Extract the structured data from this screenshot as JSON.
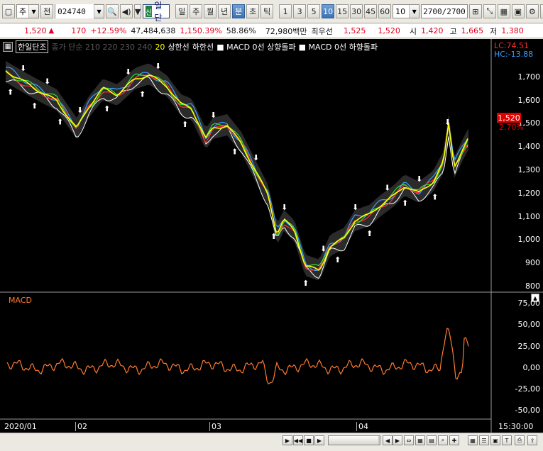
{
  "toolbar": {
    "type_label": "주",
    "prev_label": "전",
    "code": "024740",
    "badge": "신",
    "stock_name": "한일단조",
    "period_tabs": [
      "일",
      "주",
      "월",
      "년",
      "분",
      "초",
      "틱"
    ],
    "period_selected": "분",
    "intervals": [
      "1",
      "3",
      "5",
      "10",
      "15",
      "30",
      "45",
      "60"
    ],
    "interval_selected": "10",
    "interval_combo": "10",
    "count": "2700",
    "count_total": "/2700"
  },
  "quote": {
    "price": "1,520",
    "change": "170",
    "change_pct": "+12.59%",
    "volume": "47,484,638",
    "volume_ratio": "1,150.39%",
    "turnover_pct": "58.86%",
    "amount": "72,980백만",
    "best_ask_label": "최우선",
    "best_ask": "1,525",
    "best_bid": "1,520",
    "open_label": "시",
    "open": "1,420",
    "high_label": "고",
    "high": "1,665",
    "low_label": "저",
    "low": "1,380"
  },
  "legend": {
    "stock_name": "한일단조",
    "ma_items": "종가 단순 210  220  230  240",
    "ma_20": "20",
    "upper_line": "상한선",
    "lower_line": "하한선",
    "macd_up": "MACD 0선 상향돌파",
    "macd_down": "MACD 0선 하향돌파"
  },
  "axis": {
    "price_ticks": [
      "1,700",
      "1,600",
      "1,500",
      "1,400",
      "1,300",
      "1,200",
      "1,100",
      "1,000",
      "900",
      "800"
    ],
    "macd_ticks": [
      "75,00",
      "50,00",
      "25,00",
      "0,00",
      "-25,00",
      "-50,00"
    ],
    "dates": [
      "2020/01",
      "02",
      "03",
      "04"
    ],
    "time": "15:30:00"
  },
  "indicators": {
    "lc": "LC:74.51",
    "hc": "HC:-13.88",
    "last_price": "1,520",
    "last_pct": "2.70%",
    "macd_label": "MACD"
  },
  "colors": {
    "up": "#e4001b",
    "down": "#1a56d6",
    "macd": "#ff7a2f",
    "ma20": "#ffff00"
  }
}
